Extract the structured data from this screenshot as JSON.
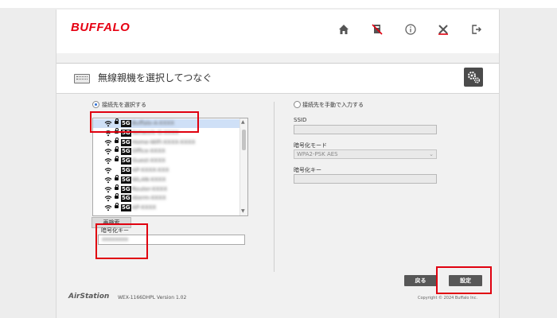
{
  "app": {
    "brand": "BUFFALO",
    "nav_icons": [
      "home-icon",
      "network-icon",
      "info-icon",
      "tools-icon",
      "logout-icon"
    ]
  },
  "page": {
    "title": "無線親機を選択してつなぐ"
  },
  "select_mode": {
    "label": "接続先を選択する",
    "selected": true
  },
  "ap_list": {
    "items": [
      {
        "band": "5G",
        "ssid": "Buffalo-A-XXXX",
        "locked": true,
        "selected": true
      },
      {
        "band": "5G",
        "ssid": "Network-G-XXXX",
        "locked": true,
        "selected": false
      },
      {
        "band": "5G",
        "ssid": "Home-WiFi-XXXX-XXXX",
        "locked": true,
        "selected": false
      },
      {
        "band": "5G",
        "ssid": "Office-XXXX",
        "locked": true,
        "selected": false
      },
      {
        "band": "5G",
        "ssid": "Guest-XXXX",
        "locked": true,
        "selected": false
      },
      {
        "band": "5G",
        "ssid": "AP-XXXX-XXX",
        "locked": false,
        "selected": false
      },
      {
        "band": "5G",
        "ssid": "WLAN-XXXX",
        "locked": true,
        "selected": false
      },
      {
        "band": "5G",
        "ssid": "Router-XXXX",
        "locked": true,
        "selected": false
      },
      {
        "band": "5G",
        "ssid": "Aterm-XXXX",
        "locked": true,
        "selected": false
      },
      {
        "band": "5G",
        "ssid": "AP-XXXX",
        "locked": true,
        "selected": false
      }
    ]
  },
  "rescan_label": "再検索",
  "enc_key_left": {
    "label": "暗号化キー",
    "value": "xxxxxxxx"
  },
  "manual_mode": {
    "label": "接続先を手動で入力する",
    "selected": false,
    "ssid_label": "SSID",
    "enc_mode_label": "暗号化モード",
    "enc_mode_value": "WPA2-PSK AES",
    "enc_key_label": "暗号化キー"
  },
  "buttons": {
    "back": "戻る",
    "apply": "設定"
  },
  "footer": {
    "brand": "AirStation",
    "model": "WEX-1166DHPL Version 1.02",
    "copyright": "Copyright © 2024 Buffalo Inc."
  },
  "colors": {
    "brand_red": "#e60012",
    "highlight_red": "#e0000f",
    "selection_blue": "#cfe0f7"
  }
}
